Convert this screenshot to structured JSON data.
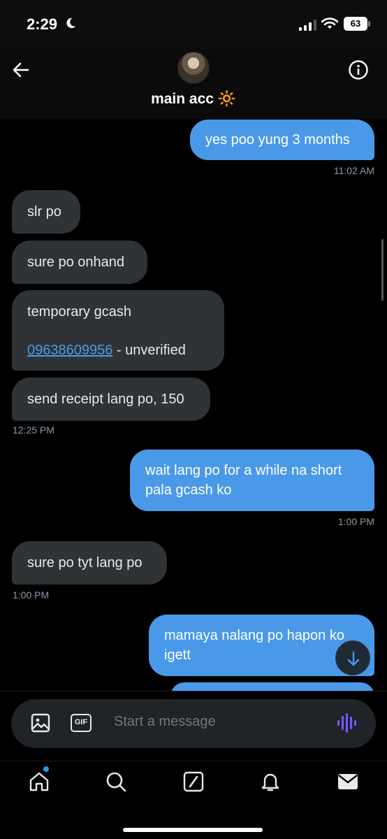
{
  "status_bar": {
    "time": "2:29",
    "battery": "63"
  },
  "header": {
    "title": "main acc 🔆"
  },
  "messages": [
    {
      "dir": "out",
      "lines": [
        "yes poo yung 3 months"
      ],
      "time": "11:02 AM"
    },
    {
      "dir": "in",
      "lines": [
        "slr po"
      ]
    },
    {
      "dir": "in",
      "lines": [
        "sure po onhand"
      ]
    },
    {
      "dir": "in",
      "text_top": "temporary gcash",
      "link": "09638609956",
      "link_suffix": " - unverified"
    },
    {
      "dir": "in",
      "lines": [
        "send receipt lang po, 150"
      ],
      "time": "12:25 PM"
    },
    {
      "dir": "out",
      "lines": [
        "wait lang po for a while na short",
        "pala gcash ko"
      ],
      "time": "1:00 PM"
    },
    {
      "dir": "in",
      "lines": [
        "sure po tyt lang po"
      ],
      "time": "1:00 PM"
    },
    {
      "dir": "out",
      "lines": [
        "mamaya nalang po hapon ko",
        "igett"
      ]
    }
  ],
  "composer": {
    "placeholder": "Start a message",
    "gif_label": "GIF"
  },
  "icons": {
    "back": "back-arrow-icon",
    "info": "info-icon",
    "image": "image-icon",
    "gif": "gif-icon",
    "voice": "voice-icon",
    "scroll_down": "arrow-down-icon",
    "tabs": [
      "home-icon",
      "search-icon",
      "grok-icon",
      "notifications-icon",
      "messages-icon"
    ]
  },
  "colors": {
    "accent": "#4a99e9",
    "incoming_bubble": "#2f3336",
    "voice": "#7856ff"
  }
}
